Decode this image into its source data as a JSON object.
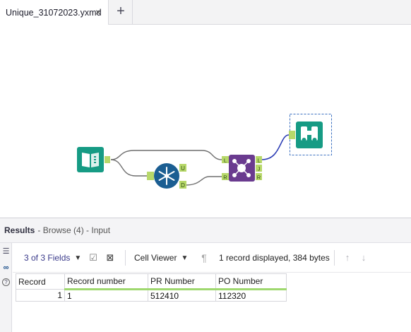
{
  "tab": {
    "filename": "Unique_31072023.yxmd",
    "close_glyph": "×",
    "add_glyph": "+"
  },
  "canvas": {
    "anchors": {
      "left_top": "L",
      "right_top": "R",
      "unique": "U",
      "duplicate": "D",
      "join_left": "L",
      "join_j": "J",
      "join_right": "R"
    },
    "colors": {
      "input_tool": "#169b84",
      "unique_tool": "#1b5e92",
      "join_tool": "#6a3b8f",
      "browse_tool": "#169b84",
      "anchor": "#b7d86a",
      "connector": "#6f6f6f",
      "connector_selected": "#2b3cb4"
    }
  },
  "results": {
    "title": "Results",
    "subtitle": "- Browse (4) - Input",
    "toolbar": {
      "fields_label": "3 of 3 Fields",
      "viewer_label": "Cell Viewer",
      "summary": "1 record displayed, 384 bytes"
    },
    "grid": {
      "columns": [
        "Record",
        "Record number",
        "PR Number",
        "PO Number"
      ],
      "rows": [
        {
          "record": "1",
          "record_number": "1",
          "pr_number": "512410",
          "po_number": "112320"
        }
      ]
    }
  }
}
